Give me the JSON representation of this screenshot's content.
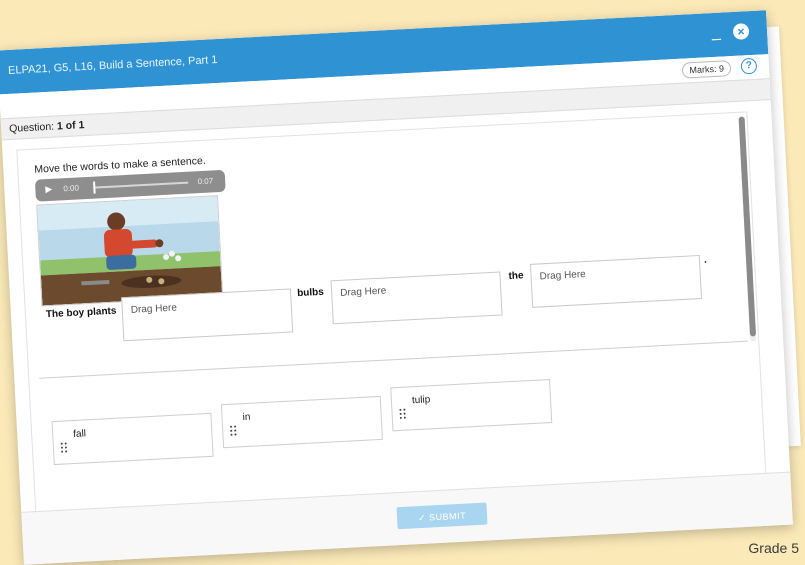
{
  "window": {
    "title": "ELPA21, G5, L16, Build a Sentence, Part 1",
    "minimize_label": "_",
    "close_label": "×",
    "marks_label": "Marks: 9",
    "help_label": "?"
  },
  "question": {
    "prefix": "Question:",
    "number": "1 of 1",
    "instructions": "Move the words to make a sentence."
  },
  "audio": {
    "current_time": "0:00",
    "duration": "0:07"
  },
  "sentence": {
    "parts": [
      "The boy plants",
      "bulbs",
      "the",
      "."
    ],
    "drop_zones": [
      "Drag Here",
      "Drag Here",
      "Drag Here"
    ]
  },
  "tiles": [
    "fall",
    "in",
    "tulip"
  ],
  "footer": {
    "submit_label": "✓  SUBMIT"
  },
  "grade_label": "Grade 5",
  "colors": {
    "accent": "#2f93d3",
    "background": "#fbe9b8",
    "submit_disabled": "#a9d5f0"
  }
}
